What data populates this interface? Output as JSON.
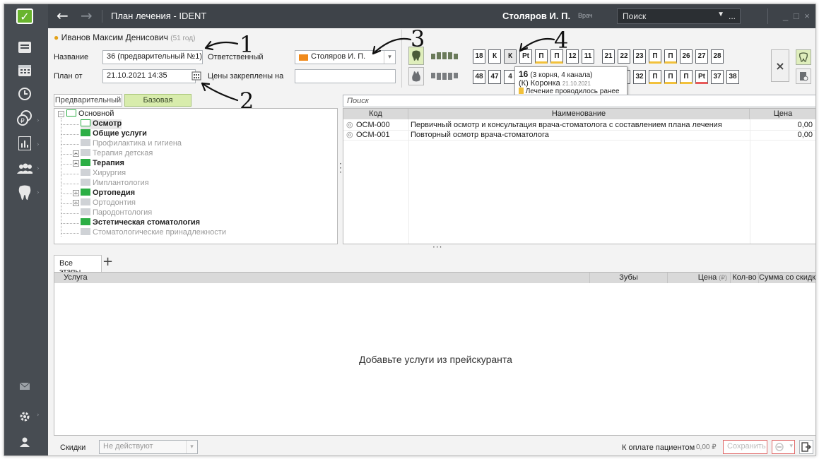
{
  "window": {
    "title": "План лечения - IDENT",
    "user_name": "Столяров И. П.",
    "user_role": "Врач",
    "search_placeholder": "Поиск",
    "search_more": "...",
    "window_controls": "_ □ ×"
  },
  "sidebar": {
    "items": [
      {
        "icon": "list-icon"
      },
      {
        "icon": "calendar-icon"
      },
      {
        "icon": "clock-icon"
      },
      {
        "icon": "coins-icon"
      },
      {
        "icon": "report-icon"
      },
      {
        "icon": "users-icon"
      },
      {
        "icon": "tooth-icon"
      },
      {
        "icon": "mail-icon"
      },
      {
        "icon": "gear-icon"
      },
      {
        "icon": "person-icon"
      }
    ]
  },
  "patient": {
    "name": "Иванов Максим Денисович",
    "age": "(51 год)"
  },
  "form": {
    "name_label": "Название",
    "name_value": "36 (предварительный №1)",
    "responsible_label": "Ответственный",
    "responsible_value": "Столяров И. П.",
    "plan_from_label": "План от",
    "plan_from_value": "21.10.2021 14:35",
    "prices_label": "Цены закреплены на",
    "prices_value": ""
  },
  "teeth": {
    "upper_left": [
      "18",
      "К",
      "К",
      "Pt",
      "П",
      "П",
      "12",
      "11"
    ],
    "upper_right": [
      "21",
      "22",
      "23",
      "П",
      "П",
      "26",
      "27",
      "28"
    ],
    "lower_left": [
      "48",
      "47",
      "4"
    ],
    "lower_right": [
      "31",
      "32",
      "П",
      "П",
      "П",
      "Pt",
      "37",
      "38"
    ]
  },
  "tooltip": {
    "tooth": "16",
    "roots": "(3 корня, 4 канала)",
    "treatment": "(К) Коронка",
    "date": "21.10.2021",
    "note": "Лечение проводилось ранее"
  },
  "annotations": [
    "1",
    "2",
    "3",
    "4"
  ],
  "tabs": {
    "preliminary": "Предварительный",
    "base": "Базовая"
  },
  "tree": {
    "root": "Основной",
    "items": [
      {
        "label": "Осмотр",
        "style": "bold",
        "folder": "o"
      },
      {
        "label": "Общие услуги",
        "style": "bold",
        "folder": "g"
      },
      {
        "label": "Профилактика и гигиена",
        "style": "gray",
        "folder": "l"
      },
      {
        "label": "Терапия детская",
        "style": "gray",
        "folder": "l",
        "expand": true
      },
      {
        "label": "Терапия",
        "style": "bold",
        "folder": "g",
        "expand": true
      },
      {
        "label": "Хирургия",
        "style": "gray",
        "folder": "l"
      },
      {
        "label": "Имплантология",
        "style": "gray",
        "folder": "l"
      },
      {
        "label": "Ортопедия",
        "style": "bold",
        "folder": "g",
        "expand": true
      },
      {
        "label": "Ортодонтия",
        "style": "gray",
        "folder": "l",
        "expand": true
      },
      {
        "label": "Пародонтология",
        "style": "gray",
        "folder": "l"
      },
      {
        "label": "Эстетическая стоматология",
        "style": "bold",
        "folder": "g"
      },
      {
        "label": "Стоматологические принадлежности",
        "style": "gray",
        "folder": "l"
      }
    ]
  },
  "price_list": {
    "search_placeholder": "Поиск",
    "columns": [
      "Код",
      "Наименование",
      "Цена"
    ],
    "rows": [
      {
        "code": "OCM-000",
        "name": "Первичный осмотр и консультация врача-стоматолога с составлением плана лечения",
        "price": "0,00"
      },
      {
        "code": "OCM-001",
        "name": "Повторный осмотр врача-стоматолога",
        "price": "0,00"
      }
    ]
  },
  "stages": {
    "all_label": "Все этапы",
    "add_label": "+"
  },
  "services": {
    "columns": {
      "service": "Услуга",
      "teeth": "Зубы",
      "price": "Цена",
      "price_unit": "(₽)",
      "qty": "Кол-во",
      "sum": "Сумма со скидкой",
      "sum_unit": "(₽)"
    },
    "empty_text": "Добавьте услуги из прейскуранта"
  },
  "footer": {
    "discount_label": "Скидки",
    "discount_value": "Не действуют",
    "to_pay_label": "К оплате пациентом",
    "to_pay_value": "0,00 ₽",
    "save_label": "Сохранить"
  }
}
